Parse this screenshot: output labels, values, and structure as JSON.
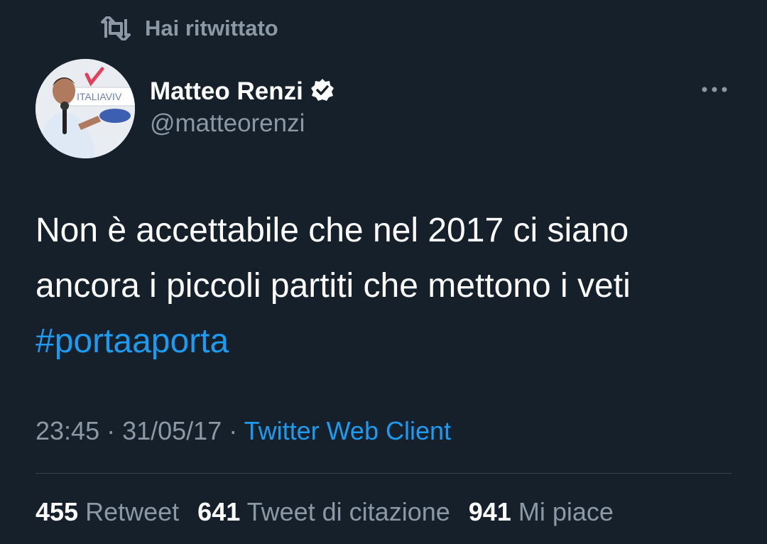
{
  "retweet_banner": {
    "icon": "retweet-icon",
    "label": "Hai ritwittato"
  },
  "author": {
    "name": "Matteo Renzi",
    "verified_icon": "verified-badge-icon",
    "handle": "@matteorenzi",
    "avatar_banner_text": "ITALIAVIV"
  },
  "more_icon": "more-options-icon",
  "tweet": {
    "line1": "Non è accettabile che nel 2017 ci siano",
    "line2": "ancora i piccoli partiti che mettono i veti",
    "hashtag": "#portaaporta"
  },
  "meta": {
    "time": "23:45",
    "separator1": " · ",
    "date": "31/05/17",
    "separator2": " · ",
    "client": "Twitter Web Client"
  },
  "stats": {
    "retweets_count": "455",
    "retweets_label": "Retweet",
    "quotes_count": "641",
    "quotes_label": "Tweet di citazione",
    "likes_count": "941",
    "likes_label": "Mi piace"
  },
  "colors": {
    "background": "#15202b",
    "text_primary": "#ffffff",
    "text_secondary": "#8b98a5",
    "link": "#1d9bf0",
    "divider": "#38444d"
  }
}
